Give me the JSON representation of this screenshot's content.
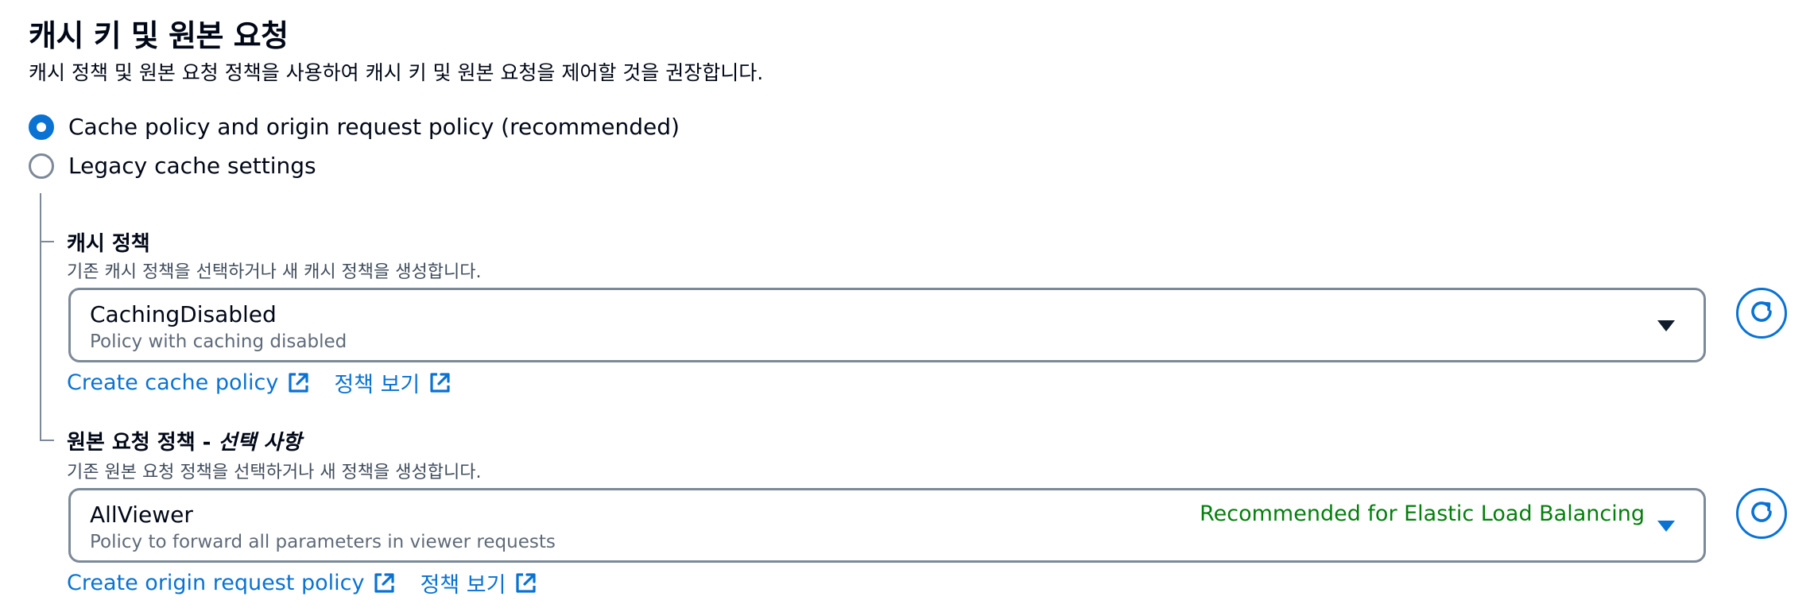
{
  "section": {
    "title": "캐시 키 및 원본 요청",
    "description": "캐시 정책 및 원본 요청 정책을 사용하여 캐시 키 및 원본 요청을 제어할 것을 권장합니다."
  },
  "options": [
    {
      "label": "Cache policy and origin request policy (recommended)",
      "selected": true
    },
    {
      "label": "Legacy cache settings",
      "selected": false
    }
  ],
  "cache_policy": {
    "label": "캐시 정책",
    "description": "기존 캐시 정책을 선택하거나 새 캐시 정책을 생성합니다.",
    "selected_value": "CachingDisabled",
    "selected_description": "Policy with caching disabled",
    "links": {
      "create": "Create cache policy",
      "view": "정책 보기"
    }
  },
  "origin_request_policy": {
    "label": "원본 요청 정책 - ",
    "label_optional": "선택 사항",
    "description": "기존 원본 요청 정책을 선택하거나 새 정책을 생성합니다.",
    "selected_value": "AllViewer",
    "selected_description": "Policy to forward all parameters in viewer requests",
    "tag": "Recommended for Elastic Load Balancing",
    "links": {
      "create": "Create origin request policy",
      "view": "정책 보기"
    }
  },
  "icons": {
    "refresh": "refresh-icon",
    "external": "external-link-icon",
    "caret": "caret-down-icon"
  },
  "colors": {
    "accent": "#0972d3",
    "success": "#037f0c",
    "text": "#000716",
    "border": "#7d8998"
  }
}
